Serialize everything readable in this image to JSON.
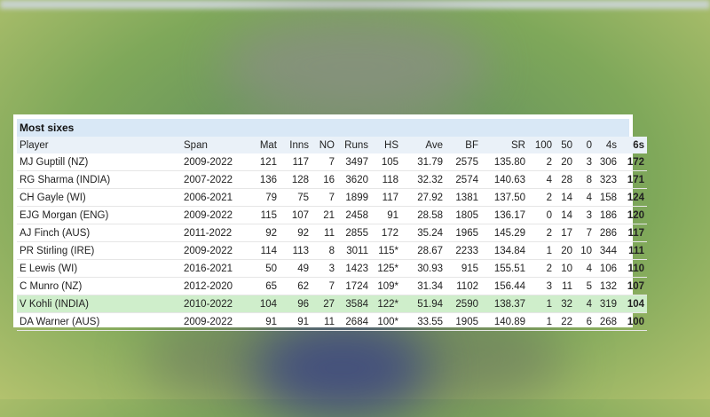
{
  "table": {
    "title": "Most sixes",
    "columns": [
      "Player",
      "Span",
      "Mat",
      "Inns",
      "NO",
      "Runs",
      "HS",
      "Ave",
      "BF",
      "SR",
      "100",
      "50",
      "0",
      "4s",
      "6s"
    ],
    "highlight_row": 8,
    "highlight_color": "#cfeecb",
    "rows": [
      [
        "MJ Guptill (NZ)",
        "2009-2022",
        "121",
        "117",
        "7",
        "3497",
        "105",
        "31.79",
        "2575",
        "135.80",
        "2",
        "20",
        "3",
        "306",
        "172"
      ],
      [
        "RG Sharma (INDIA)",
        "2007-2022",
        "136",
        "128",
        "16",
        "3620",
        "118",
        "32.32",
        "2574",
        "140.63",
        "4",
        "28",
        "8",
        "323",
        "171"
      ],
      [
        "CH Gayle (WI)",
        "2006-2021",
        "79",
        "75",
        "7",
        "1899",
        "117",
        "27.92",
        "1381",
        "137.50",
        "2",
        "14",
        "4",
        "158",
        "124"
      ],
      [
        "EJG Morgan (ENG)",
        "2009-2022",
        "115",
        "107",
        "21",
        "2458",
        "91",
        "28.58",
        "1805",
        "136.17",
        "0",
        "14",
        "3",
        "186",
        "120"
      ],
      [
        "AJ Finch (AUS)",
        "2011-2022",
        "92",
        "92",
        "11",
        "2855",
        "172",
        "35.24",
        "1965",
        "145.29",
        "2",
        "17",
        "7",
        "286",
        "117"
      ],
      [
        "PR Stirling (IRE)",
        "2009-2022",
        "114",
        "113",
        "8",
        "3011",
        "115*",
        "28.67",
        "2233",
        "134.84",
        "1",
        "20",
        "10",
        "344",
        "111"
      ],
      [
        "E Lewis (WI)",
        "2016-2021",
        "50",
        "49",
        "3",
        "1423",
        "125*",
        "30.93",
        "915",
        "155.51",
        "2",
        "10",
        "4",
        "106",
        "110"
      ],
      [
        "C Munro (NZ)",
        "2012-2020",
        "65",
        "62",
        "7",
        "1724",
        "109*",
        "31.34",
        "1102",
        "156.44",
        "3",
        "11",
        "5",
        "132",
        "107"
      ],
      [
        "V Kohli (INDIA)",
        "2010-2022",
        "104",
        "96",
        "27",
        "3584",
        "122*",
        "51.94",
        "2590",
        "138.37",
        "1",
        "32",
        "4",
        "319",
        "104"
      ],
      [
        "DA Warner (AUS)",
        "2009-2022",
        "91",
        "91",
        "11",
        "2684",
        "100*",
        "33.55",
        "1905",
        "140.89",
        "1",
        "22",
        "6",
        "268",
        "100"
      ]
    ]
  }
}
